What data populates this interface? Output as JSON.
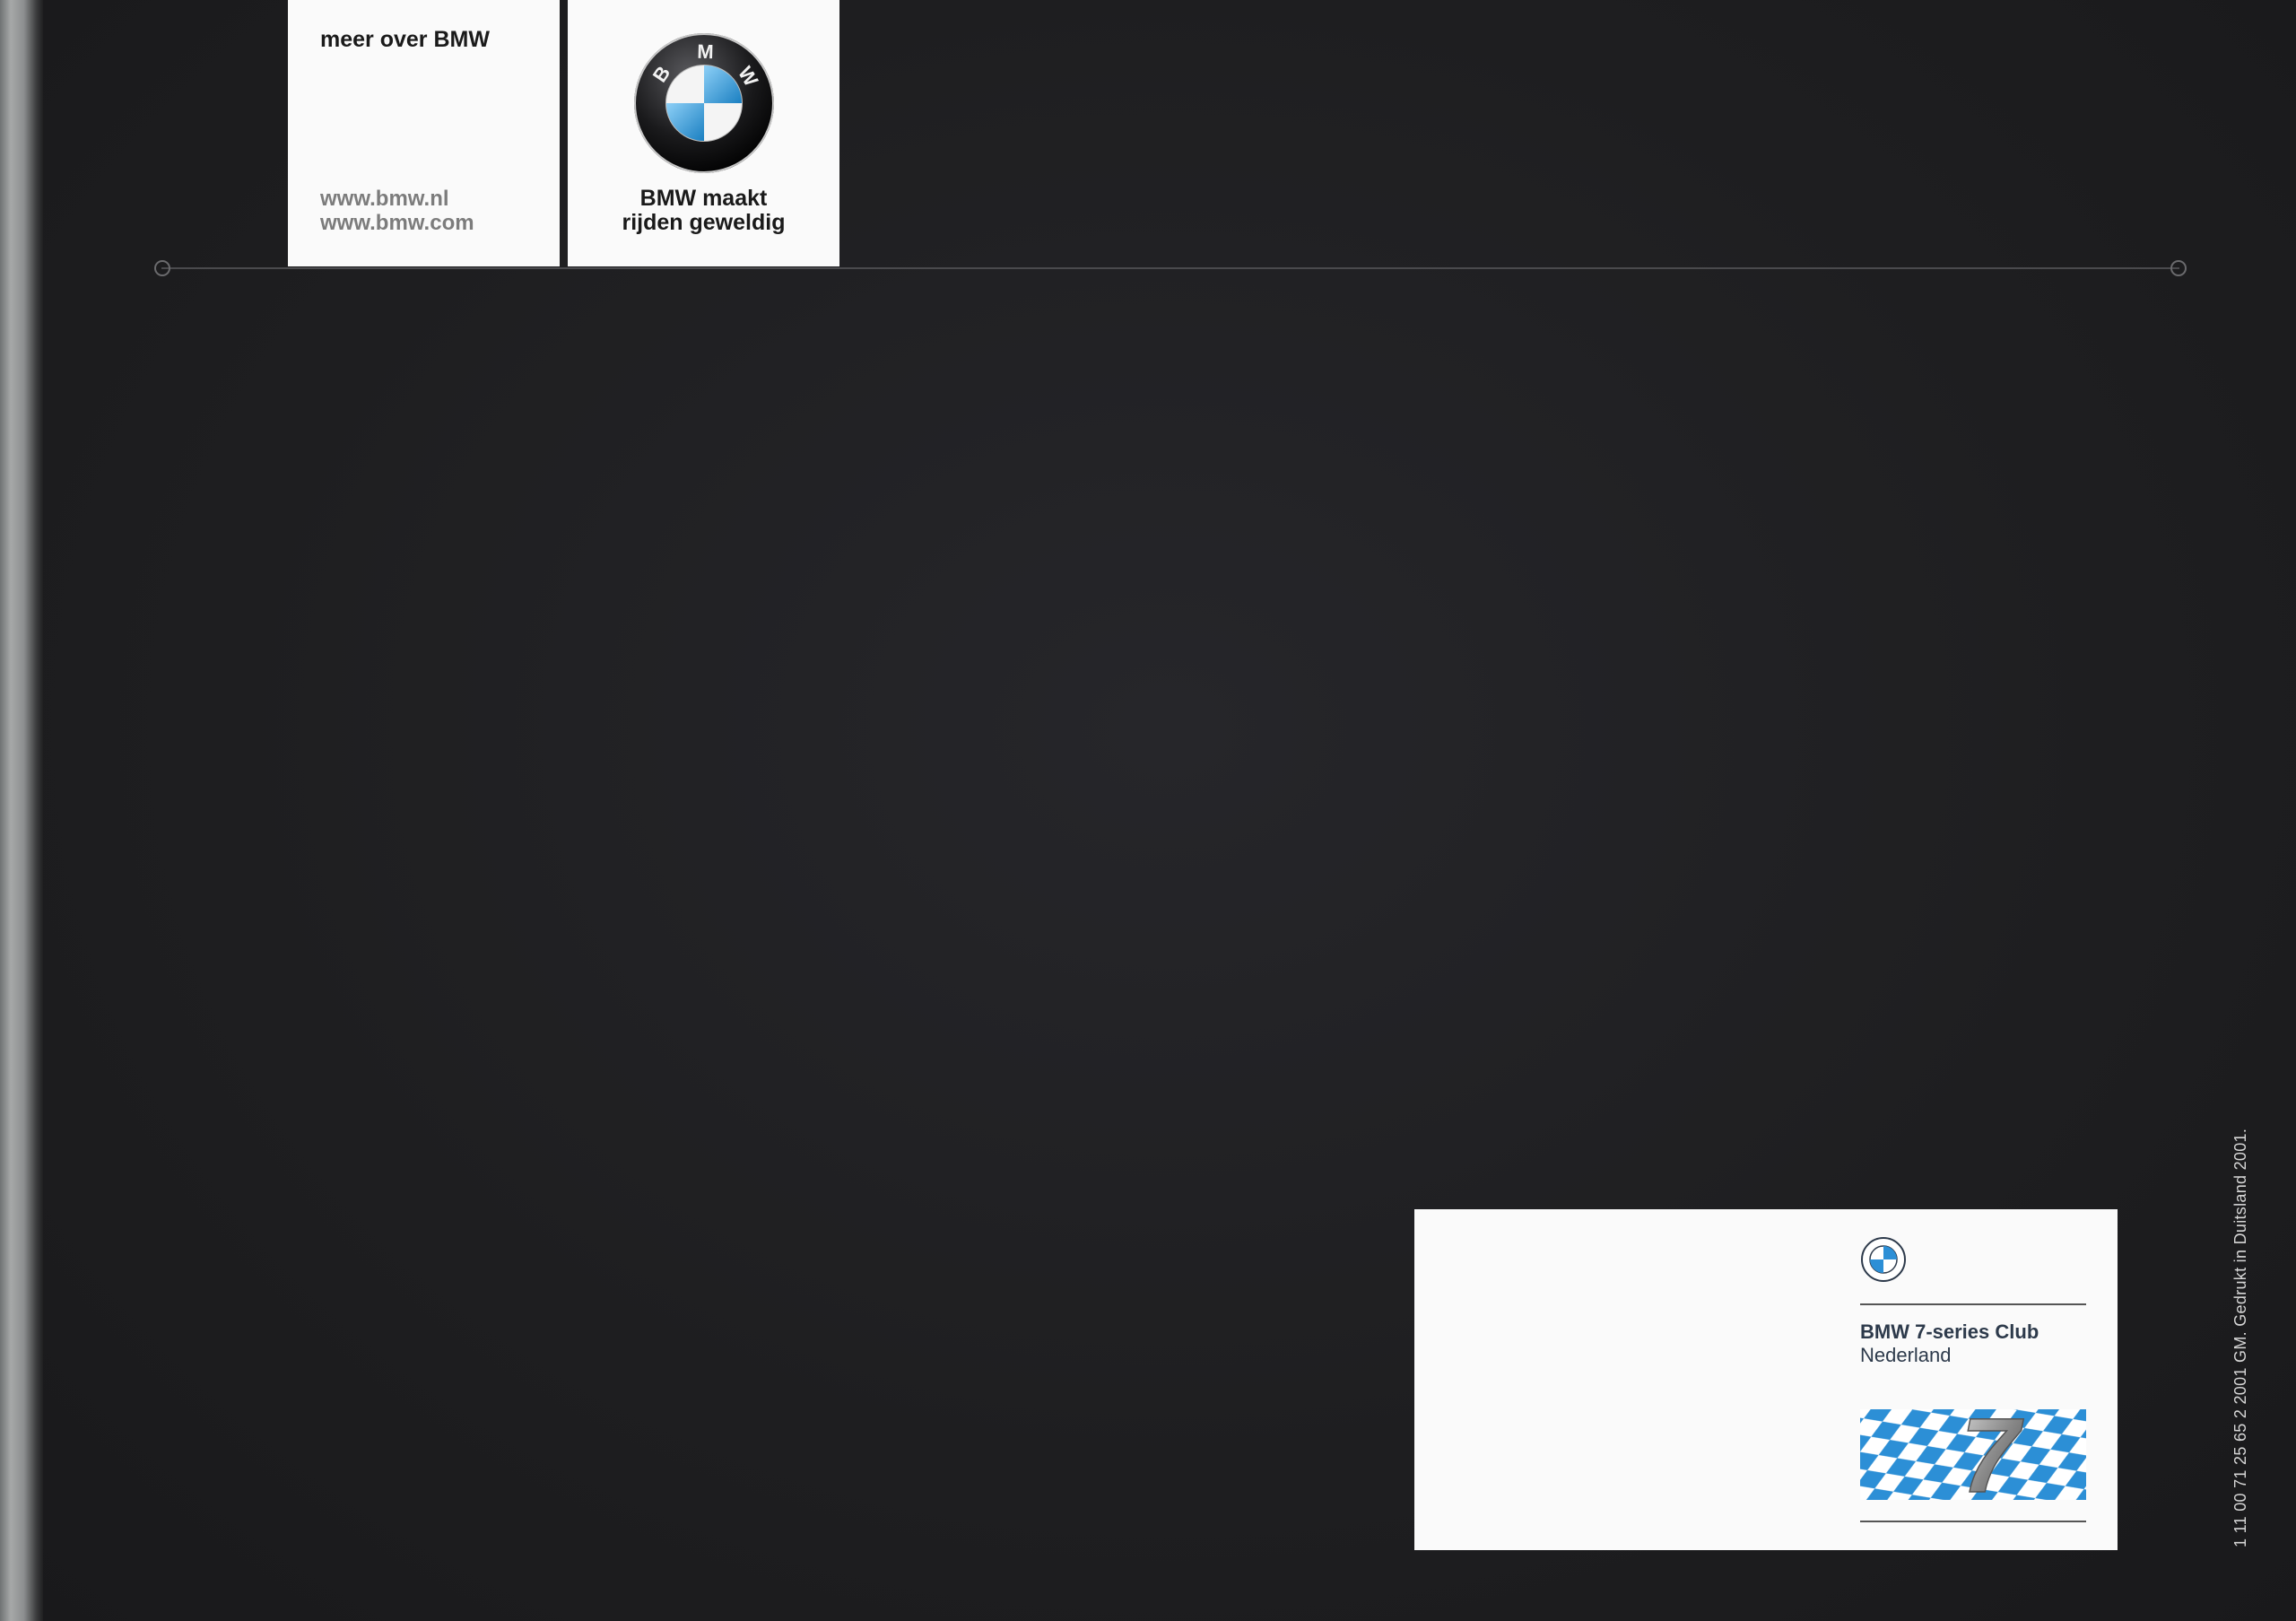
{
  "cards": {
    "more": {
      "title": "meer over BMW",
      "links": [
        "www.bmw.nl",
        "www.bmw.com"
      ]
    },
    "logo": {
      "logo_letters": [
        "B",
        "M",
        "W"
      ],
      "slogan_line1": "BMW maakt",
      "slogan_line2": "rijden geweldig"
    }
  },
  "club": {
    "name": "BMW 7-series Club",
    "country": "Nederland",
    "emblem_number": "7"
  },
  "print_note": "1 11 00 71 25 65 2 2001 GM. Gedrukt in Duitsland 2001.",
  "colors": {
    "cover": "#1e1e1f",
    "bmw_blue": "#1a7fc1",
    "bavarian_blue": "#2c8fd6",
    "card": "#fafafa"
  }
}
